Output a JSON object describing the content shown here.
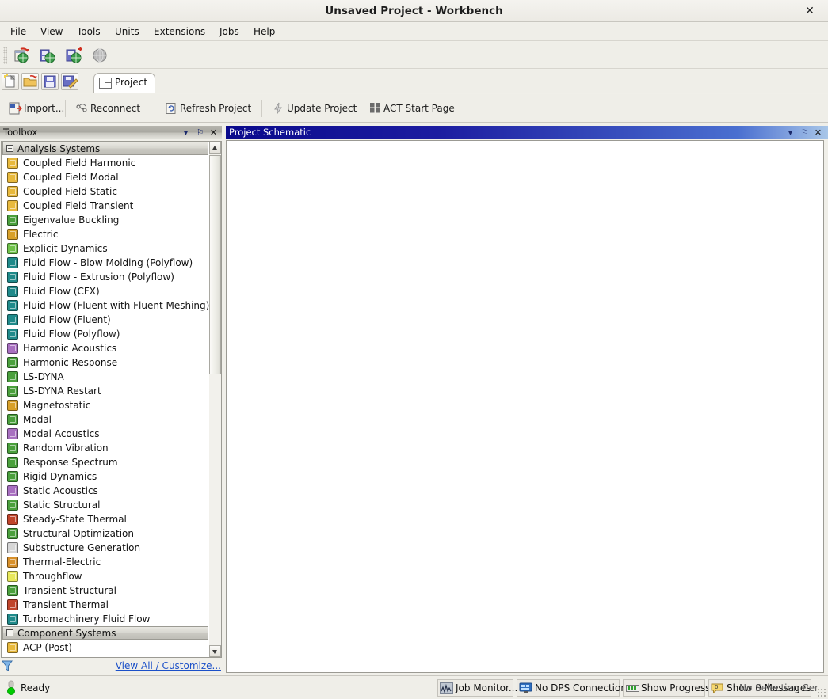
{
  "window": {
    "title": "Unsaved Project - Workbench",
    "close_label": "✕"
  },
  "menu": [
    {
      "label": "File",
      "accel": "F"
    },
    {
      "label": "View",
      "accel": "V"
    },
    {
      "label": "Tools",
      "accel": "T"
    },
    {
      "label": "Units",
      "accel": "U"
    },
    {
      "label": "Extensions",
      "accel": "E"
    },
    {
      "label": "Jobs",
      "accel": "J"
    },
    {
      "label": "Help",
      "accel": "H"
    }
  ],
  "main_toolbar": {
    "buttons": [
      {
        "name": "new-project-globe-icon"
      },
      {
        "name": "open-project-globe-icon"
      },
      {
        "name": "save-project-globe-icon"
      },
      {
        "name": "globe-icon"
      }
    ]
  },
  "tabstrip": {
    "buttons": [
      {
        "name": "new-file-icon"
      },
      {
        "name": "open-folder-icon"
      },
      {
        "name": "save-icon"
      },
      {
        "name": "save-as-icon"
      }
    ],
    "tab_label": "Project"
  },
  "second_toolbar": {
    "buttons": [
      {
        "label": "Import...",
        "icon": "import-icon"
      },
      {
        "label": "Reconnect",
        "icon": "reconnect-icon"
      },
      {
        "label": "Refresh Project",
        "icon": "refresh-icon"
      },
      {
        "label": "Update Project",
        "icon": "update-icon"
      },
      {
        "label": "ACT Start Page",
        "icon": "act-grid-icon"
      }
    ]
  },
  "toolbox": {
    "title": "Toolbox",
    "header_buttons": {
      "dropdown": "▾",
      "pin": "⚐",
      "close": "✕"
    },
    "groups": [
      {
        "label": "Analysis Systems",
        "expander": "−",
        "items": [
          {
            "label": "Coupled Field Harmonic",
            "color": "#e8b93c",
            "icon": "coupled-field-icon"
          },
          {
            "label": "Coupled Field Modal",
            "color": "#e8b93c",
            "icon": "coupled-field-icon"
          },
          {
            "label": "Coupled Field Static",
            "color": "#e8b93c",
            "icon": "coupled-field-icon"
          },
          {
            "label": "Coupled Field Transient",
            "color": "#e8b93c",
            "icon": "coupled-field-icon"
          },
          {
            "label": "Eigenvalue Buckling",
            "color": "#4aa03c",
            "icon": "buckling-icon"
          },
          {
            "label": "Electric",
            "color": "#d8a028",
            "icon": "electric-icon"
          },
          {
            "label": "Explicit Dynamics",
            "color": "#6fc24a",
            "icon": "explicit-dynamics-icon"
          },
          {
            "label": "Fluid Flow - Blow Molding (Polyflow)",
            "color": "#1f8a8a",
            "icon": "fluid-flow-icon"
          },
          {
            "label": "Fluid Flow - Extrusion (Polyflow)",
            "color": "#1f8a8a",
            "icon": "fluid-flow-icon"
          },
          {
            "label": "Fluid Flow (CFX)",
            "color": "#1f8a8a",
            "icon": "fluid-flow-icon"
          },
          {
            "label": "Fluid Flow (Fluent with Fluent Meshing)",
            "color": "#1f8a8a",
            "icon": "fluid-flow-icon"
          },
          {
            "label": "Fluid Flow (Fluent)",
            "color": "#1f8a8a",
            "icon": "fluid-flow-icon"
          },
          {
            "label": "Fluid Flow (Polyflow)",
            "color": "#1f8a8a",
            "icon": "fluid-flow-icon"
          },
          {
            "label": "Harmonic Acoustics",
            "color": "#a86fc0",
            "icon": "acoustics-icon"
          },
          {
            "label": "Harmonic Response",
            "color": "#4aa03c",
            "icon": "harmonic-response-icon"
          },
          {
            "label": "LS-DYNA",
            "color": "#4aa03c",
            "icon": "ls-dyna-icon"
          },
          {
            "label": "LS-DYNA Restart",
            "color": "#4aa03c",
            "icon": "ls-dyna-icon"
          },
          {
            "label": "Magnetostatic",
            "color": "#d8a028",
            "icon": "magnetostatic-icon"
          },
          {
            "label": "Modal",
            "color": "#4aa03c",
            "icon": "modal-icon"
          },
          {
            "label": "Modal Acoustics",
            "color": "#a86fc0",
            "icon": "acoustics-icon"
          },
          {
            "label": "Random Vibration",
            "color": "#4aa03c",
            "icon": "random-vibration-icon"
          },
          {
            "label": "Response Spectrum",
            "color": "#4aa03c",
            "icon": "response-spectrum-icon"
          },
          {
            "label": "Rigid Dynamics",
            "color": "#4aa03c",
            "icon": "rigid-dynamics-icon"
          },
          {
            "label": "Static Acoustics",
            "color": "#a86fc0",
            "icon": "acoustics-icon"
          },
          {
            "label": "Static Structural",
            "color": "#4aa03c",
            "icon": "static-structural-icon"
          },
          {
            "label": "Steady-State Thermal",
            "color": "#c0442a",
            "icon": "thermal-icon"
          },
          {
            "label": "Structural Optimization",
            "color": "#4aa03c",
            "icon": "structural-optimization-icon"
          },
          {
            "label": "Substructure Generation",
            "color": "#d6d6d6",
            "icon": "substructure-icon"
          },
          {
            "label": "Thermal-Electric",
            "color": "#d8902a",
            "icon": "thermal-electric-icon"
          },
          {
            "label": "Throughflow",
            "color": "#e8e85a",
            "icon": "throughflow-icon"
          },
          {
            "label": "Transient Structural",
            "color": "#4aa03c",
            "icon": "transient-structural-icon"
          },
          {
            "label": "Transient Thermal",
            "color": "#c0442a",
            "icon": "transient-thermal-icon"
          },
          {
            "label": "Turbomachinery Fluid Flow",
            "color": "#1f8a8a",
            "icon": "fluid-flow-icon"
          }
        ]
      },
      {
        "label": "Component Systems",
        "expander": "−",
        "items": [
          {
            "label": "ACP (Post)",
            "color": "#e8b93c",
            "icon": "acp-post-icon"
          }
        ]
      }
    ],
    "footer": {
      "filter_icon": "funnel-icon",
      "view_all_label": "View All / Customize..."
    }
  },
  "schematic": {
    "title": "Project Schematic",
    "header_buttons": {
      "dropdown": "▾",
      "pin": "⚐",
      "close": "✕"
    }
  },
  "statusbar": {
    "ready_label": "Ready",
    "status_light": "green",
    "cells": [
      {
        "label": "Job Monitor...",
        "icon": "job-monitor-icon"
      },
      {
        "label": "No DPS Connection",
        "icon": "dps-monitor-icon"
      },
      {
        "label": "Show Progress",
        "icon": "progress-icon"
      },
      {
        "label": "Show 0 Messages",
        "icon": "message-balloon-icon",
        "badge": "0"
      }
    ],
    "overlay_artifact": "No Selection   Cer"
  },
  "colors": {
    "accent_blue": "#0a0a8c",
    "link_blue": "#1b50c8",
    "chrome": "#efeee8",
    "status_green": "#00cc00"
  }
}
